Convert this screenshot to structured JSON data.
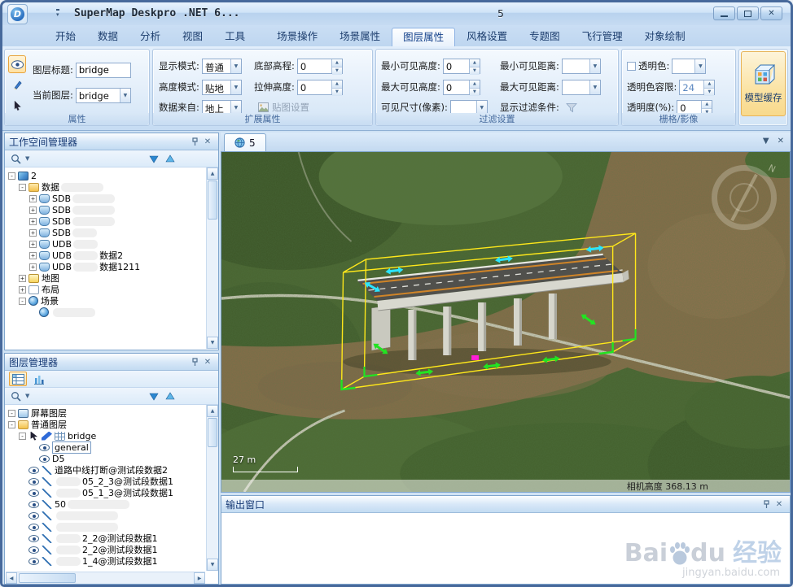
{
  "titlebar": {
    "app_title": "SuperMap Deskpro .NET 6...",
    "doc_title": "5"
  },
  "ribbon": {
    "tabs": [
      {
        "label": "开始"
      },
      {
        "label": "数据"
      },
      {
        "label": "分析"
      },
      {
        "label": "视图"
      },
      {
        "label": "工具"
      },
      {
        "label": "场景操作"
      },
      {
        "label": "场景属性"
      },
      {
        "label": "图层属性",
        "active": true
      },
      {
        "label": "风格设置"
      },
      {
        "label": "专题图"
      },
      {
        "label": "飞行管理"
      },
      {
        "label": "对象绘制"
      }
    ],
    "attr_group": {
      "title": "属性",
      "layer_title_label": "图层标题:",
      "layer_title_value": "bridge",
      "current_layer_label": "当前图层:",
      "current_layer_value": "bridge"
    },
    "ext_group": {
      "title": "扩展属性",
      "display_mode_label": "显示模式:",
      "display_mode_value": "普通",
      "height_mode_label": "高度模式:",
      "height_mode_value": "贴地",
      "data_from_label": "数据来自:",
      "data_from_value": "地上",
      "bottom_elev_label": "底部高程:",
      "bottom_elev_value": "0",
      "stretch_height_label": "拉伸高度:",
      "stretch_height_value": "0",
      "texture_btn_label": "贴图设置"
    },
    "filter_group": {
      "title": "过滤设置",
      "min_height_label": "最小可见高度:",
      "min_height_value": "0",
      "max_height_label": "最大可见高度:",
      "max_height_value": "0",
      "visible_size_label": "可见尺寸(像素):",
      "min_dist_label": "最小可见距离:",
      "max_dist_label": "最大可见距离:",
      "filter_cond_label": "显示过滤条件:"
    },
    "raster_group": {
      "title": "栅格/影像",
      "transparent_label": "透明色:",
      "tolerance_label": "透明色容限:",
      "tolerance_value": "24",
      "opacity_label": "透明度(%):",
      "opacity_value": "0"
    },
    "model_cache_label": "模型缓存"
  },
  "workspace_panel": {
    "title": "工作空间管理器",
    "tree": [
      {
        "indent": 0,
        "expand": "-",
        "icons": [
          "workspace"
        ],
        "label": "2"
      },
      {
        "indent": 1,
        "expand": "-",
        "icons": [
          "dsfolder"
        ],
        "label": "数据",
        "blob_after": "md"
      },
      {
        "indent": 2,
        "expand": "+",
        "icons": [
          "db"
        ],
        "label": "SDB",
        "blob_after": "md"
      },
      {
        "indent": 2,
        "expand": "+",
        "icons": [
          "db"
        ],
        "label": "SDB",
        "blob_after": "md"
      },
      {
        "indent": 2,
        "expand": "+",
        "icons": [
          "db"
        ],
        "label": "SDB",
        "blob_after": "md"
      },
      {
        "indent": 2,
        "expand": "+",
        "icons": [
          "db"
        ],
        "label": "SDB",
        "blob_after": "sm"
      },
      {
        "indent": 2,
        "expand": "+",
        "icons": [
          "db"
        ],
        "label": "UDB",
        "blob_after": "sm"
      },
      {
        "indent": 2,
        "expand": "+",
        "icons": [
          "db"
        ],
        "label": "UDB",
        "blob_after": "sm",
        "label2": "数据2"
      },
      {
        "indent": 2,
        "expand": "+",
        "icons": [
          "db"
        ],
        "label": "UDB",
        "blob_after": "sm",
        "label2": "数据1211"
      },
      {
        "indent": 1,
        "expand": "+",
        "icons": [
          "map"
        ],
        "label": "地图"
      },
      {
        "indent": 1,
        "expand": "+",
        "icons": [
          "layout"
        ],
        "label": "布局"
      },
      {
        "indent": 1,
        "expand": "-",
        "icons": [
          "scene"
        ],
        "label": "场景"
      },
      {
        "indent": 2,
        "icons": [
          "globe"
        ],
        "label": "",
        "blob_after": "md"
      }
    ]
  },
  "layer_panel": {
    "title": "图层管理器",
    "tree": [
      {
        "indent": 0,
        "expand": "-",
        "icons": [
          "screen"
        ],
        "label": "屏幕图层"
      },
      {
        "indent": 0,
        "expand": "-",
        "icons": [
          "folder"
        ],
        "label": "普通图层"
      },
      {
        "indent": 1,
        "expand": "-",
        "icons": [
          "cursor",
          "pen",
          "hash"
        ],
        "label": "bridge"
      },
      {
        "indent": 2,
        "icons": [
          "eye"
        ],
        "label": "general",
        "boxed": true
      },
      {
        "indent": 2,
        "icons": [
          "eye"
        ],
        "label": "D5"
      },
      {
        "indent": 1,
        "icons": [
          "eye",
          "arrow"
        ],
        "label": "道路中线打断@测试段数据2"
      },
      {
        "indent": 1,
        "icons": [
          "eye",
          "arrow"
        ],
        "blob_before": "sm",
        "label": "05_2_3@测试段数据1"
      },
      {
        "indent": 1,
        "icons": [
          "eye",
          "arrow"
        ],
        "blob_before": "sm",
        "label": "05_1_3@测试段数据1"
      },
      {
        "indent": 1,
        "icons": [
          "eye",
          "arrow"
        ],
        "label": "50",
        "blob_after": "lg"
      },
      {
        "indent": 1,
        "icons": [
          "eye",
          "arrow"
        ],
        "label": "",
        "blob_after": "lg"
      },
      {
        "indent": 1,
        "icons": [
          "eye",
          "arrow"
        ],
        "label": "",
        "blob_after": "lg"
      },
      {
        "indent": 1,
        "icons": [
          "eye",
          "arrow"
        ],
        "blob_before": "sm",
        "label": "2_2@测试段数据1"
      },
      {
        "indent": 1,
        "icons": [
          "eye",
          "arrow"
        ],
        "blob_before": "sm",
        "label": "2_2@测试段数据1"
      },
      {
        "indent": 1,
        "icons": [
          "eye",
          "arrow"
        ],
        "blob_before": "sm",
        "label": "1_4@测试段数据1"
      }
    ]
  },
  "scene": {
    "tab_label": "5",
    "scale_label": "27 m",
    "camera_height_label": "相机高度 368.13 m"
  },
  "output_panel": {
    "title": "输出窗口"
  },
  "watermark": {
    "part1": "Bai",
    "part2": "du",
    "part3": "经验",
    "url": "jingyan.baidu.com"
  }
}
